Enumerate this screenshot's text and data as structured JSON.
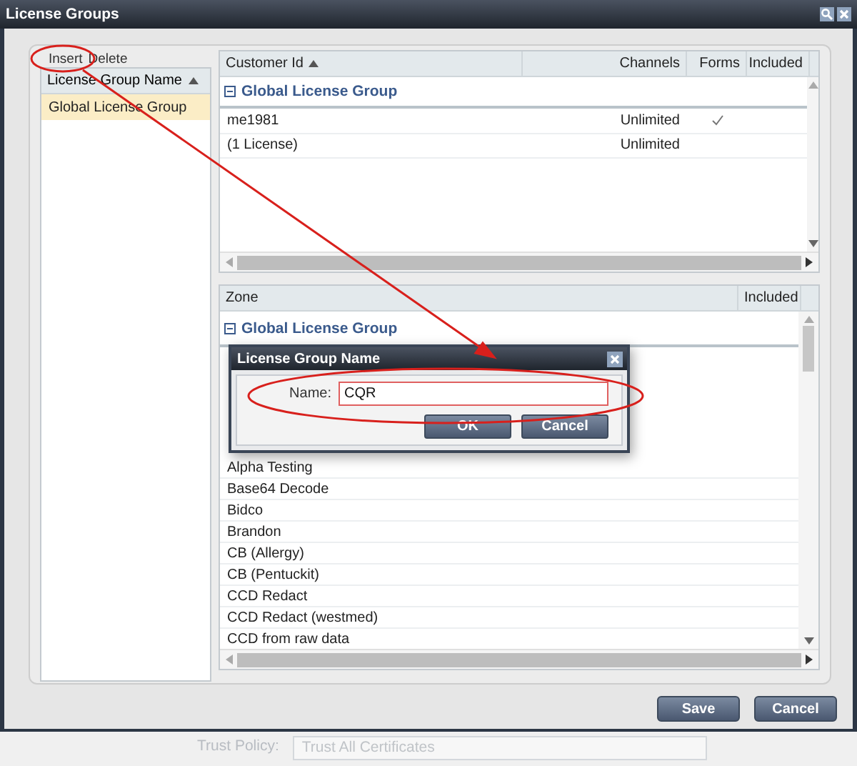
{
  "window": {
    "title": "License Groups"
  },
  "toolbar": [
    {
      "label": "Insert"
    },
    {
      "label": "Delete"
    }
  ],
  "groups_list": {
    "column": "License Group Name",
    "sorted": true,
    "rows": [
      {
        "name": "Global License Group",
        "selected": true
      }
    ]
  },
  "customers": {
    "columns": [
      {
        "label": "Customer Id",
        "sorted": true
      },
      {
        "label": "Channels",
        "sorted": false
      },
      {
        "label": "Forms",
        "sorted": false
      },
      {
        "label": "Included",
        "sorted": false
      }
    ],
    "group": "Global License Group",
    "rows": [
      {
        "customer_id": "me1981",
        "channels": "Unlimited",
        "forms": true
      },
      {
        "customer_id": "(1 License)",
        "channels": "Unlimited",
        "forms": false
      }
    ]
  },
  "zones": {
    "columns": [
      "Zone",
      "Included"
    ],
    "group": "Global License Group",
    "rows": [
      "Alpha Testing",
      "Base64 Decode",
      "Bidco",
      "Brandon",
      "CB (Allergy)",
      "CB (Pentuckit)",
      "CCD Redact",
      "CCD Redact (westmed)",
      "CCD from raw data"
    ]
  },
  "dialog": {
    "title": "License Group Name",
    "field_label": "Name:",
    "value": "CQR",
    "buttons": [
      "OK",
      "Cancel"
    ]
  },
  "buttons": [
    "Save",
    "Cancel"
  ],
  "background": {
    "label": "Trust Policy:",
    "value": "Trust All Certificates"
  }
}
